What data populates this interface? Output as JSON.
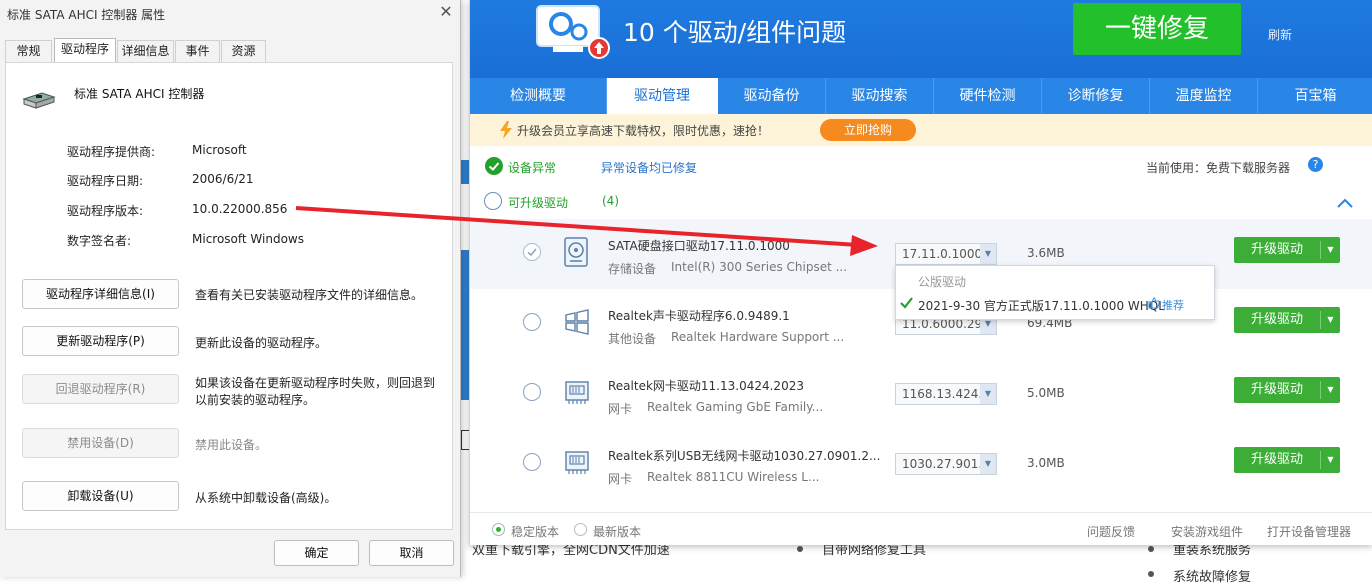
{
  "background": {
    "footer_left": "双重下载引擎，全网CDN文件加速",
    "footer_mid": "自带网络修复工具",
    "footer_right": "重装系统服务",
    "footer_right2": "系统故障修复"
  },
  "dialog": {
    "title": "标准 SATA AHCI 控制器 属性",
    "tabs": [
      "常规",
      "驱动程序",
      "详细信息",
      "事件",
      "资源"
    ],
    "device_name": "标准 SATA AHCI 控制器",
    "fields": [
      {
        "key": "驱动程序提供商:",
        "value": "Microsoft"
      },
      {
        "key": "驱动程序日期:",
        "value": "2006/6/21"
      },
      {
        "key": "驱动程序版本:",
        "value": "10.0.22000.856"
      },
      {
        "key": "数字签名者:",
        "value": "Microsoft Windows"
      }
    ],
    "buttons": [
      {
        "label": "驱动程序详细信息(I)",
        "desc": "查看有关已安装驱动程序文件的详细信息。",
        "enabled": true
      },
      {
        "label": "更新驱动程序(P)",
        "desc": "更新此设备的驱动程序。",
        "enabled": true
      },
      {
        "label": "回退驱动程序(R)",
        "desc": "如果该设备在更新驱动程序时失败，则回退到以前安装的驱动程序。",
        "enabled": false
      },
      {
        "label": "禁用设备(D)",
        "desc": "禁用此设备。",
        "enabled": false
      },
      {
        "label": "卸载设备(U)",
        "desc": "从系统中卸载设备(高级)。",
        "enabled": true
      }
    ],
    "ok_label": "确定",
    "cancel_label": "取消"
  },
  "tool": {
    "headline": "10 个驱动/组件问题",
    "fix_button": "一键修复",
    "refresh": "刷新",
    "tabs": [
      "检测概要",
      "驱动管理",
      "驱动备份",
      "驱动搜索",
      "硬件检测",
      "诊断修复",
      "温度监控",
      "百宝箱"
    ],
    "promo_text": "升级会员立享高速下载特权，限时优惠，速抢！",
    "promo_button": "立即抢购",
    "status_abnormal": "设备异常",
    "status_fixed": "异常设备均已修复",
    "server_label": "当前使用：免费下载服务器",
    "upgradable": "可升级驱动",
    "upgradable_count": "(4)",
    "drivers": [
      {
        "name": "SATA硬盘接口驱动17.11.0.1000",
        "category": "存储设备",
        "device": "Intel(R) 300 Series Chipset ...",
        "version": "17.11.0.1000",
        "size": "3.6MB",
        "icon": "hdd-icon"
      },
      {
        "name": "Realtek声卡驱动程序6.0.9489.1",
        "category": "其他设备",
        "device": "Realtek Hardware Support ...",
        "version": "11.0.6000.29",
        "size": "69.4MB",
        "icon": "windows-icon"
      },
      {
        "name": "Realtek网卡驱动11.13.0424.2023",
        "category": "网卡",
        "device": "Realtek Gaming GbE Family...",
        "version": "1168.13.424.",
        "size": "5.0MB",
        "icon": "network-card-icon"
      },
      {
        "name": "Realtek系列USB无线网卡驱动1030.27.0901.2...",
        "category": "网卡",
        "device": "Realtek 8811CU Wireless L...",
        "version": "1030.27.901.",
        "size": "3.0MB",
        "icon": "network-card-icon"
      }
    ],
    "upgrade_label": "升级驱动",
    "popup_header": "公版驱动",
    "popup_version": "2021-9-30 官方正式版17.11.0.1000 WHQL",
    "popup_recommend": "推荐",
    "footer": {
      "stable": "稳定版本",
      "latest": "最新版本",
      "feedback": "问题反馈",
      "game_components": "安装游戏组件",
      "device_manager": "打开设备管理器"
    }
  },
  "colors": {
    "header_blue": "#1f7ae0",
    "fix_green": "#22c02a",
    "upgrade_green": "#3cad37",
    "arrow_red": "#e8232c",
    "promo_orange": "#f58a1f"
  }
}
